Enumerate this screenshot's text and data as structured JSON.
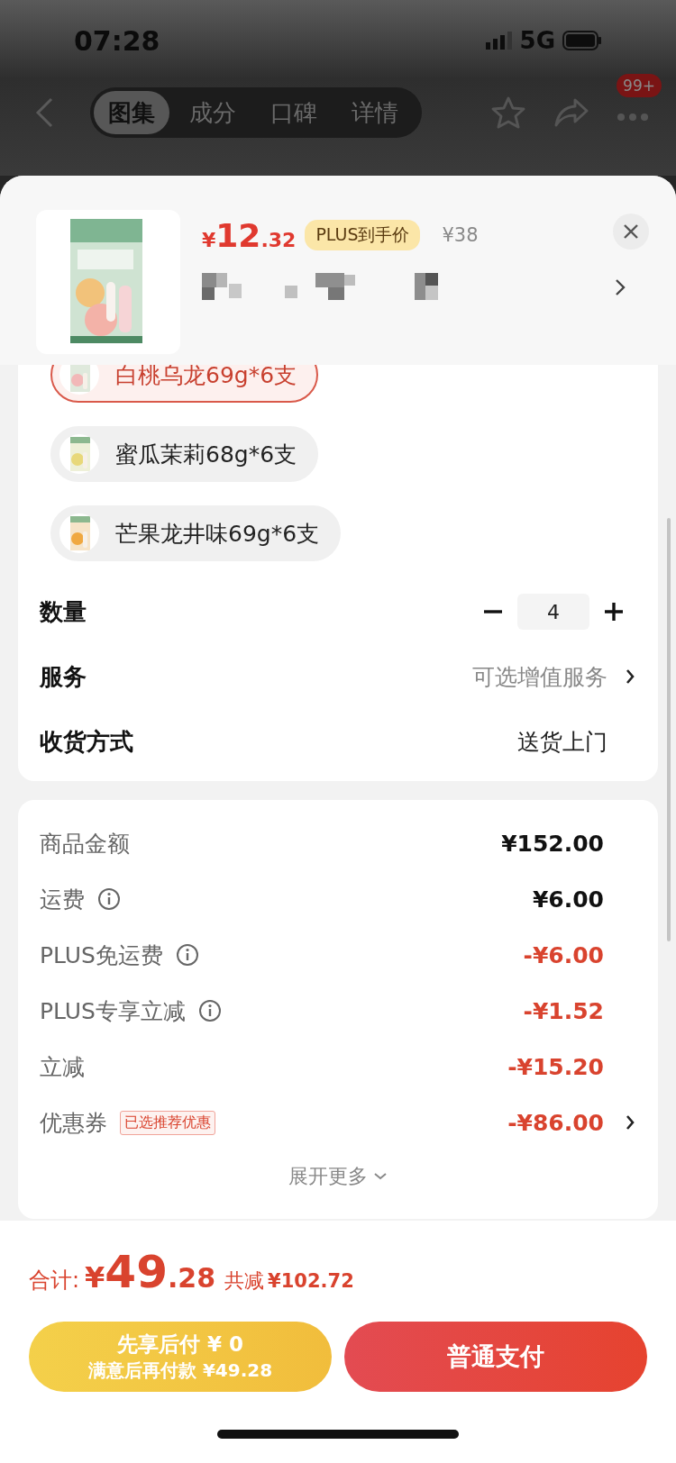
{
  "status_bar": {
    "time": "07:28",
    "network": "5G"
  },
  "nav": {
    "tabs": [
      {
        "label": "图集",
        "selected": true
      },
      {
        "label": "成分",
        "selected": false
      },
      {
        "label": "口碑",
        "selected": false
      },
      {
        "label": "详情",
        "selected": false
      }
    ],
    "badge": "99+"
  },
  "product": {
    "price": {
      "symbol": "¥",
      "integer": "12",
      "decimal": ".32"
    },
    "plus_tag": "PLUS到手价",
    "original_price": "¥38"
  },
  "variants": [
    {
      "label": "白桃乌龙69g*6支",
      "selected": true
    },
    {
      "label": "蜜瓜茉莉68g*6支",
      "selected": false
    },
    {
      "label": "芒果龙井味69g*6支",
      "selected": false
    }
  ],
  "quantity": {
    "label": "数量",
    "value": "4"
  },
  "options": [
    {
      "label": "服务",
      "value": "可选增值服务",
      "arrow": true
    },
    {
      "label": "收货方式",
      "value": "送货上门",
      "arrow": false
    }
  ],
  "summary": {
    "rows": [
      {
        "label": "商品金额",
        "info": false,
        "amount": "¥152.00",
        "kind": "charge",
        "arrow": false
      },
      {
        "label": "运费",
        "info": true,
        "amount": "¥6.00",
        "kind": "charge",
        "arrow": false
      },
      {
        "label": "PLUS免运费",
        "info": true,
        "amount": "-¥6.00",
        "kind": "discount",
        "arrow": false
      },
      {
        "label": "PLUS专享立减",
        "info": true,
        "amount": "-¥1.52",
        "kind": "discount",
        "arrow": false
      },
      {
        "label": "立减",
        "info": false,
        "amount": "-¥15.20",
        "kind": "discount",
        "arrow": false
      },
      {
        "label": "优惠券",
        "info": false,
        "tag": "已选推荐优惠",
        "amount": "-¥86.00",
        "kind": "discount",
        "arrow": true
      }
    ],
    "expand": "展开更多"
  },
  "footer": {
    "total_label": "合计:",
    "total": {
      "symbol": "¥",
      "integer": "49",
      "decimal": ".28"
    },
    "saved_label": "共减",
    "saved_amount": "¥102.72",
    "pay_later": {
      "title": "先享后付 ¥ 0",
      "subtitle": "满意后再付款 ¥49.28"
    },
    "pay_button": "普通支付"
  }
}
